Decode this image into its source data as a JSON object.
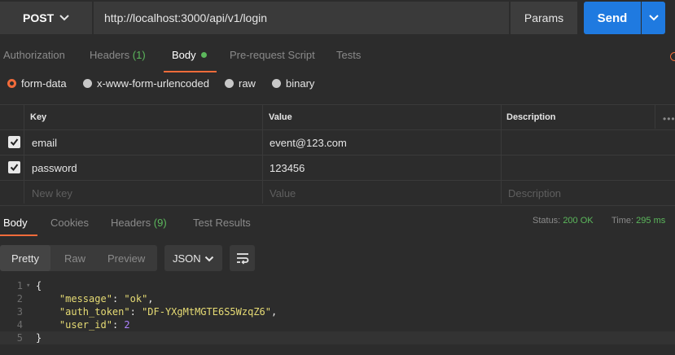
{
  "request": {
    "method": "POST",
    "url": "http://localhost:3000/api/v1/login",
    "params_label": "Params",
    "send_label": "Send"
  },
  "request_tabs": [
    {
      "label": "Authorization"
    },
    {
      "label": "Headers",
      "count": "(1)"
    },
    {
      "label": "Body"
    },
    {
      "label": "Pre-request Script"
    },
    {
      "label": "Tests"
    }
  ],
  "body_types": [
    {
      "label": "form-data",
      "selected": true
    },
    {
      "label": "x-www-form-urlencoded"
    },
    {
      "label": "raw"
    },
    {
      "label": "binary"
    }
  ],
  "table": {
    "headers": {
      "key": "Key",
      "value": "Value",
      "description": "Description"
    },
    "rows": [
      {
        "key": "email",
        "value": "event@123.com",
        "checked": true
      },
      {
        "key": "password",
        "value": "123456",
        "checked": true
      }
    ],
    "placeholder": {
      "key": "New key",
      "value": "Value",
      "description": "Description"
    }
  },
  "response_tabs": [
    {
      "label": "Body"
    },
    {
      "label": "Cookies"
    },
    {
      "label": "Headers",
      "count": "(9)"
    },
    {
      "label": "Test Results"
    }
  ],
  "response_status": {
    "status_label": "Status:",
    "status_value": "200 OK",
    "time_label": "Time:",
    "time_value": "295 ms"
  },
  "view_modes": [
    "Pretty",
    "Raw",
    "Preview"
  ],
  "format": "JSON",
  "code_lines": [
    {
      "n": "1",
      "tokens": [
        {
          "t": "{",
          "c": "p"
        }
      ]
    },
    {
      "n": "2",
      "tokens": [
        {
          "t": "    ",
          "c": "p"
        },
        {
          "t": "\"message\"",
          "c": "k"
        },
        {
          "t": ": ",
          "c": "p"
        },
        {
          "t": "\"ok\"",
          "c": "s"
        },
        {
          "t": ",",
          "c": "p"
        }
      ]
    },
    {
      "n": "3",
      "tokens": [
        {
          "t": "    ",
          "c": "p"
        },
        {
          "t": "\"auth_token\"",
          "c": "k"
        },
        {
          "t": ": ",
          "c": "p"
        },
        {
          "t": "\"DF-YXgMtMGTE6S5WzqZ6\"",
          "c": "s"
        },
        {
          "t": ",",
          "c": "p"
        }
      ]
    },
    {
      "n": "4",
      "tokens": [
        {
          "t": "    ",
          "c": "p"
        },
        {
          "t": "\"user_id\"",
          "c": "k"
        },
        {
          "t": ": ",
          "c": "p"
        },
        {
          "t": "2",
          "c": "n"
        }
      ]
    },
    {
      "n": "5",
      "tokens": [
        {
          "t": "}",
          "c": "p"
        }
      ]
    }
  ],
  "colors": {
    "accent": "#f26b3a",
    "send": "#1f7ae0",
    "success": "#5cb85c"
  }
}
